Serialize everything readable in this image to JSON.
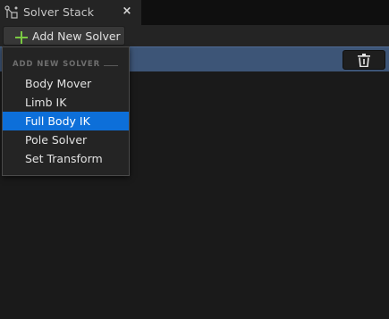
{
  "window": {
    "title": "Solver Stack",
    "close_glyph": "×"
  },
  "toolbar": {
    "add_label": "Add New Solver"
  },
  "menu": {
    "header": "ADD NEW SOLVER",
    "items": [
      {
        "label": "Body Mover"
      },
      {
        "label": "Limb IK"
      },
      {
        "label": "Full Body IK",
        "highlighted": true
      },
      {
        "label": "Pole Solver"
      },
      {
        "label": "Set Transform"
      }
    ]
  },
  "colors": {
    "background": "#1a1a1a",
    "selected_row": "#3d5577",
    "menu_highlight": "#0d6fd9",
    "plus_green": "#7ac943"
  },
  "icons": {
    "tab": "solver-stack-icon",
    "add": "plus-icon",
    "delete": "trash-icon"
  }
}
